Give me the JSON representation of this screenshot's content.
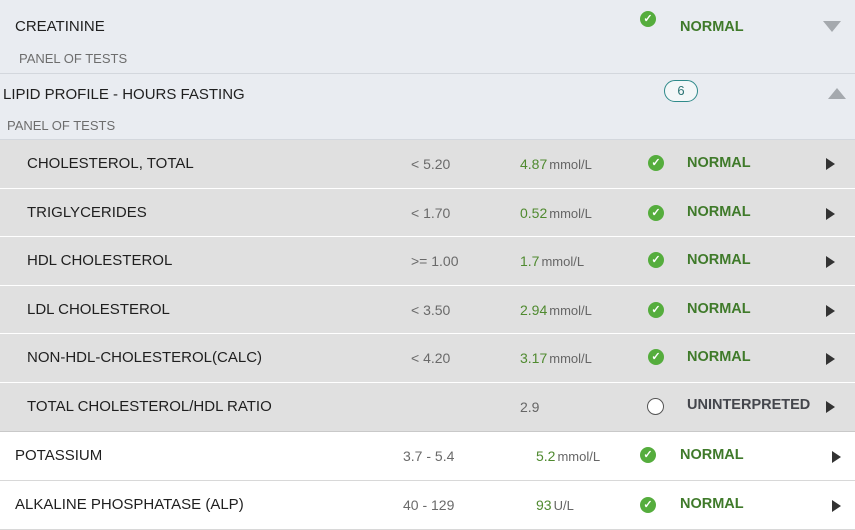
{
  "creatinine": {
    "name": "CREATININE",
    "panel": "PANEL OF TESTS",
    "status": "NORMAL"
  },
  "lipid": {
    "name": "LIPID PROFILE - HOURS FASTING",
    "panel": "PANEL OF TESTS",
    "count": "6"
  },
  "subtests": [
    {
      "name": "CHOLESTEROL, TOTAL",
      "range": "< 5.20",
      "value": "4.87",
      "unit": "mmol/L",
      "status": "NORMAL",
      "icon": "check-icon"
    },
    {
      "name": "TRIGLYCERIDES",
      "range": "< 1.70",
      "value": "0.52",
      "unit": "mmol/L",
      "status": "NORMAL",
      "icon": "check-icon"
    },
    {
      "name": "HDL CHOLESTEROL",
      "range": ">= 1.00",
      "value": "1.7",
      "unit": "mmol/L",
      "status": "NORMAL",
      "icon": "check-icon"
    },
    {
      "name": "LDL CHOLESTEROL",
      "range": "< 3.50",
      "value": "2.94",
      "unit": "mmol/L",
      "status": "NORMAL",
      "icon": "check-icon"
    },
    {
      "name": "NON-HDL-CHOLESTEROL(CALC)",
      "range": "< 4.20",
      "value": "3.17",
      "unit": "mmol/L",
      "status": "NORMAL",
      "icon": "check-icon"
    },
    {
      "name": "TOTAL CHOLESTEROL/HDL RATIO",
      "range": "",
      "value": "2.9",
      "unit": "",
      "status": "UNINTERPRETED",
      "icon": "empty-circle-icon"
    }
  ],
  "tests": [
    {
      "name": "POTASSIUM",
      "range": "3.7 - 5.4",
      "value": "5.2",
      "unit": "mmol/L",
      "status": "NORMAL"
    },
    {
      "name": "ALKALINE PHOSPHATASE (ALP)",
      "range": "40 - 129",
      "value": "93",
      "unit": "U/L",
      "status": "NORMAL"
    }
  ],
  "colors": {
    "normal": "#3f7a2a",
    "value": "#4f8a2f",
    "check": "#55ad3d",
    "badge": "#2f8a8a"
  }
}
